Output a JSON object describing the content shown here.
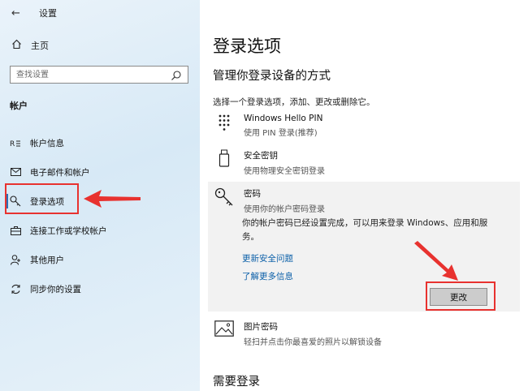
{
  "window": {
    "title": "设置"
  },
  "sidebar": {
    "home_label": "主页",
    "search_placeholder": "查找设置",
    "section_header": "帐户",
    "items": [
      {
        "label": "帐户信息",
        "icon": "person-card-icon"
      },
      {
        "label": "电子邮件和帐户",
        "icon": "mail-icon"
      },
      {
        "label": "登录选项",
        "icon": "key-icon",
        "active": true
      },
      {
        "label": "连接工作或学校帐户",
        "icon": "briefcase-icon"
      },
      {
        "label": "其他用户",
        "icon": "add-person-icon"
      },
      {
        "label": "同步你的设置",
        "icon": "sync-icon"
      }
    ]
  },
  "main": {
    "title": "登录选项",
    "subtitle": "管理你登录设备的方式",
    "description": "选择一个登录选项，添加、更改或删除它。",
    "options": {
      "pin": {
        "title": "Windows Hello PIN",
        "subtitle": "使用 PIN 登录(推荐)"
      },
      "security_key": {
        "title": "安全密钥",
        "subtitle": "使用物理安全密钥登录"
      },
      "password": {
        "title": "密码",
        "subtitle": "使用你的帐户密码登录",
        "body": "你的帐户密码已经设置完成，可以用来登录 Windows、应用和服务。",
        "link_security_questions": "更新安全问题",
        "link_learn_more": "了解更多信息",
        "change_button": "更改"
      },
      "picture_password": {
        "title": "图片密码",
        "subtitle": "轻扫并点击你最喜爱的照片以解锁设备"
      }
    },
    "next_section": "需要登录"
  },
  "colors": {
    "annotation": "#e8322f",
    "link": "#0a5fa8",
    "accent": "#2b6fb5"
  }
}
